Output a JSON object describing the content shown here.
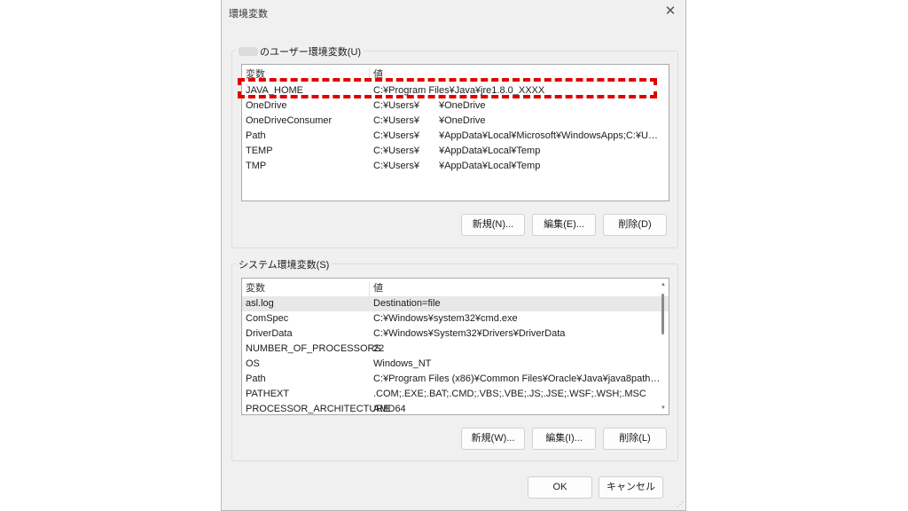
{
  "window": {
    "title": "環境変数"
  },
  "user_section": {
    "label": "のユーザー環境変数(U)",
    "columns": [
      "変数",
      "値"
    ],
    "rows": [
      {
        "name": "JAVA_HOME",
        "value": "C:¥Program Files¥Java¥jre1.8.0_XXXX"
      },
      {
        "name": "OneDrive",
        "value": "C:¥Users¥　　¥OneDrive"
      },
      {
        "name": "OneDriveConsumer",
        "value": "C:¥Users¥　　¥OneDrive"
      },
      {
        "name": "Path",
        "value": "C:¥Users¥　　¥AppData¥Local¥Microsoft¥WindowsApps;C:¥Users¥..."
      },
      {
        "name": "TEMP",
        "value": "C:¥Users¥　　¥AppData¥Local¥Temp"
      },
      {
        "name": "TMP",
        "value": "C:¥Users¥　　¥AppData¥Local¥Temp"
      }
    ],
    "buttons": {
      "new": "新規(N)...",
      "edit": "編集(E)...",
      "delete": "削除(D)"
    }
  },
  "system_section": {
    "label": "システム環境変数(S)",
    "columns": [
      "変数",
      "値"
    ],
    "rows": [
      {
        "name": "asl.log",
        "value": "Destination=file"
      },
      {
        "name": "ComSpec",
        "value": "C:¥Windows¥system32¥cmd.exe"
      },
      {
        "name": "DriverData",
        "value": "C:¥Windows¥System32¥Drivers¥DriverData"
      },
      {
        "name": "NUMBER_OF_PROCESSORS",
        "value": "22"
      },
      {
        "name": "OS",
        "value": "Windows_NT"
      },
      {
        "name": "Path",
        "value": "C:¥Program Files (x86)¥Common Files¥Oracle¥Java¥java8path;C:¥P..."
      },
      {
        "name": "PATHEXT",
        "value": ".COM;.EXE;.BAT;.CMD;.VBS;.VBE;.JS;.JSE;.WSF;.WSH;.MSC"
      },
      {
        "name": "PROCESSOR_ARCHITECTURE",
        "value": "AMD64"
      }
    ],
    "buttons": {
      "new": "新規(W)...",
      "edit": "編集(I)...",
      "delete": "削除(L)"
    }
  },
  "footer": {
    "ok": "OK",
    "cancel": "キャンセル"
  },
  "icons": {
    "close": "close-icon",
    "scroll_up": "scroll-up-arrow-icon",
    "scroll_down": "scroll-down-arrow-icon"
  },
  "colors": {
    "highlight": "#e00000",
    "selected_row": "#e8e8e8",
    "dialog_bg": "#f0f0f0"
  }
}
